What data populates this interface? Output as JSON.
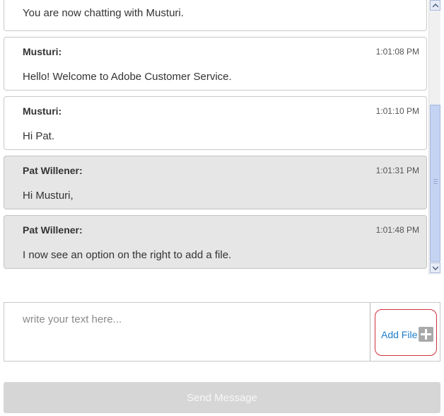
{
  "chat": {
    "system_message": "You are now chatting with Musturi.",
    "messages": [
      {
        "author": "Musturi:",
        "time": "1:01:08 PM",
        "text": "Hello! Welcome to Adobe Customer Service."
      },
      {
        "author": "Musturi:",
        "time": "1:01:10 PM",
        "text": "Hi Pat."
      },
      {
        "author": "Pat Willener:",
        "time": "1:01:31 PM",
        "text": "Hi Musturi,"
      },
      {
        "author": "Pat Willener:",
        "time": "1:01:48 PM",
        "text": "I now see an option on the right to add a file."
      }
    ]
  },
  "composer": {
    "placeholder": "write your text here...",
    "value": "",
    "add_file_label": "Add File",
    "add_file_icon": "plus-icon"
  },
  "send": {
    "label": "Send Message"
  },
  "colors": {
    "own_message_bg": "#e6e6e6",
    "agent_message_bg": "#ffffff",
    "add_file_border": "#d0303a",
    "add_file_text": "#1f7ecb",
    "send_disabled_bg": "#d6d6d6"
  }
}
